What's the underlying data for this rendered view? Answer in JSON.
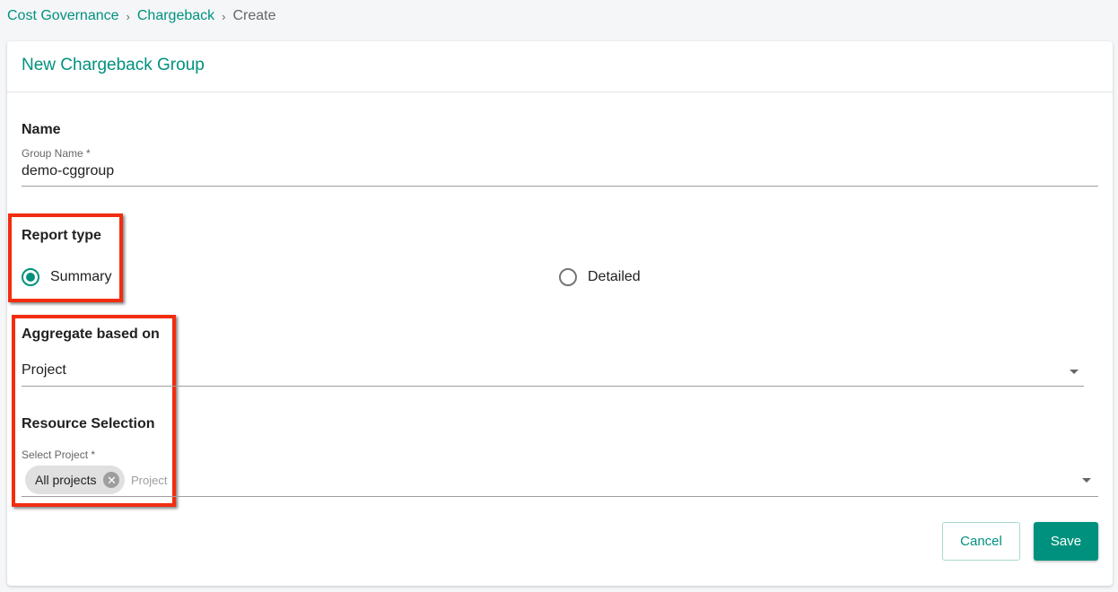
{
  "breadcrumb": {
    "items": [
      "Cost Governance",
      "Chargeback"
    ],
    "current": "Create",
    "separator": "›"
  },
  "card": {
    "title": "New Chargeback Group"
  },
  "name_section": {
    "heading": "Name",
    "field_label": "Group Name *",
    "field_value": "demo-cggroup"
  },
  "report_type": {
    "heading": "Report type",
    "options": [
      {
        "label": "Summary",
        "selected": true
      },
      {
        "label": "Detailed",
        "selected": false
      }
    ]
  },
  "aggregate": {
    "heading": "Aggregate based on",
    "selected": "Project"
  },
  "resource": {
    "heading": "Resource Selection",
    "field_label": "Select Project *",
    "chips": [
      "All projects"
    ],
    "placeholder": "Project"
  },
  "actions": {
    "cancel": "Cancel",
    "save": "Save"
  },
  "colors": {
    "accent": "#00917e",
    "annotation": "#f22d0f"
  }
}
